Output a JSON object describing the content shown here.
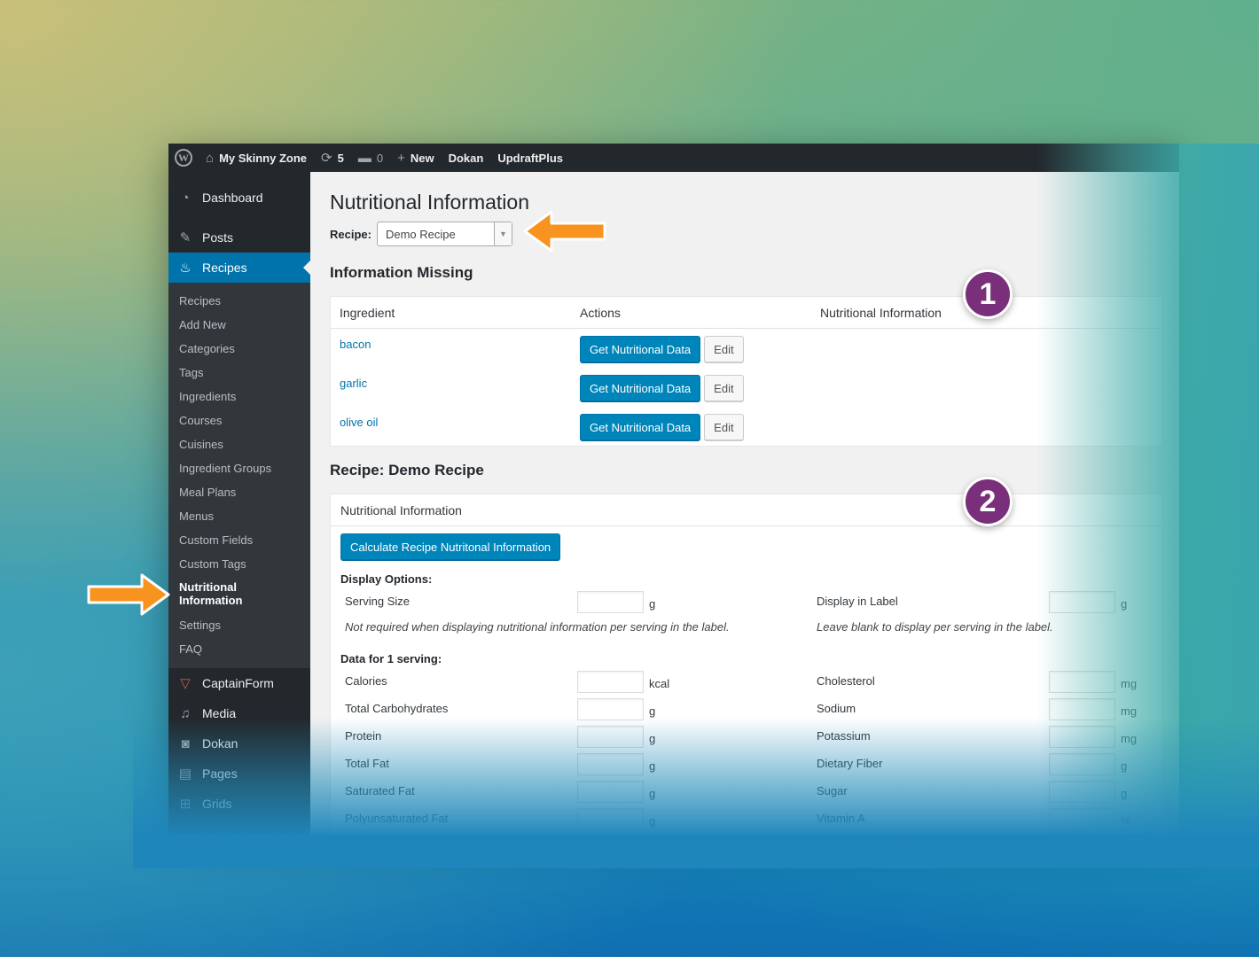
{
  "adminbar": {
    "site_name": "My Skinny Zone",
    "updates_count": "5",
    "comments_count": "0",
    "new_label": "New",
    "dokan_label": "Dokan",
    "updraft_label": "UpdraftPlus"
  },
  "sidebar": {
    "top_items": [
      {
        "label": "Dashboard",
        "icon": "dashboard-icon"
      },
      {
        "label": "Posts",
        "icon": "pin-icon"
      },
      {
        "label": "Recipes",
        "icon": "chef-icon"
      }
    ],
    "recipes_submenu": [
      "Recipes",
      "Add New",
      "Categories",
      "Tags",
      "Ingredients",
      "Courses",
      "Cuisines",
      "Ingredient Groups",
      "Meal Plans",
      "Menus",
      "Custom Fields",
      "Custom Tags",
      "Nutritional Information",
      "Settings",
      "FAQ"
    ],
    "bottom_items": [
      {
        "label": "CaptainForm",
        "icon": "captainform-icon"
      },
      {
        "label": "Media",
        "icon": "media-icon"
      },
      {
        "label": "Dokan",
        "icon": "dokan-icon"
      },
      {
        "label": "Pages",
        "icon": "pages-icon"
      },
      {
        "label": "Grids",
        "icon": "grid-icon"
      }
    ]
  },
  "main": {
    "title": "Nutritional Information",
    "recipe_label": "Recipe:",
    "recipe_selected": "Demo Recipe",
    "missing_heading": "Information Missing",
    "table_headers": [
      "Ingredient",
      "Actions",
      "Nutritional Information"
    ],
    "ingredients": [
      "bacon",
      "garlic",
      "olive oil"
    ],
    "get_data_label": "Get Nutritional Data",
    "edit_label": "Edit",
    "recipe_heading": "Recipe: Demo Recipe",
    "box2_title": "Nutritional Information",
    "calculate_label": "Calculate Recipe Nutritonal Information",
    "display_options_label": "Display Options:",
    "serving_size_label": "Serving Size",
    "serving_size_unit": "g",
    "display_in_label": "Display in Label",
    "display_in_label_unit": "g",
    "serving_note": "Not required when displaying nutritional information per serving in the label.",
    "label_note": "Leave blank to display per serving in the label.",
    "data_heading": "Data for 1 serving:",
    "nutrients_left": [
      {
        "label": "Calories",
        "unit": "kcal"
      },
      {
        "label": "Total Carbohydrates",
        "unit": "g"
      },
      {
        "label": "Protein",
        "unit": "g"
      },
      {
        "label": "Total Fat",
        "unit": "g"
      },
      {
        "label": "Saturated Fat",
        "unit": "g"
      },
      {
        "label": "Polyunsaturated Fat",
        "unit": "g"
      }
    ],
    "nutrients_right": [
      {
        "label": "Cholesterol",
        "unit": "mg"
      },
      {
        "label": "Sodium",
        "unit": "mg"
      },
      {
        "label": "Potassium",
        "unit": "mg"
      },
      {
        "label": "Dietary Fiber",
        "unit": "g"
      },
      {
        "label": "Sugar",
        "unit": "g"
      },
      {
        "label": "Vitamin A",
        "unit": "%"
      }
    ]
  },
  "callouts": {
    "badge1": "1",
    "badge2": "2"
  },
  "colors": {
    "wp_blue": "#0073aa",
    "admin_dark": "#23282d",
    "badge_purple": "#7a2f7b",
    "arrow_orange": "#f7931e"
  }
}
